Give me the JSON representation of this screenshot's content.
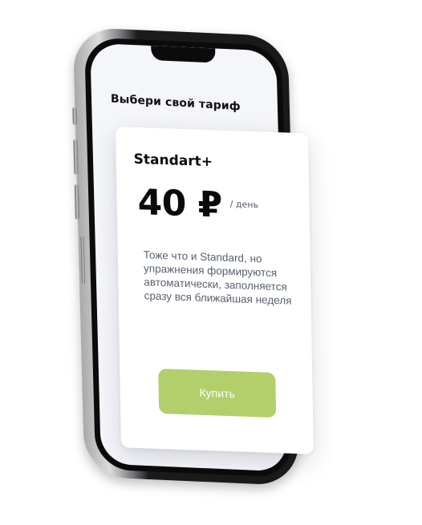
{
  "screen": {
    "title": "Выбери свой тариф"
  },
  "plan": {
    "name": "Standart+",
    "price": "40 ₽",
    "price_unit": "/ день",
    "description": "Тоже что и Standard, но упражнения формируются автоматически, заполняется сразу вся ближайшая неделя",
    "buy_label": "Купить"
  },
  "colors": {
    "accent": "#b2cf6c",
    "screen_bg": "#f5f6fa",
    "card_bg": "#ffffff",
    "title_text": "#111111",
    "body_text": "#59606e"
  }
}
